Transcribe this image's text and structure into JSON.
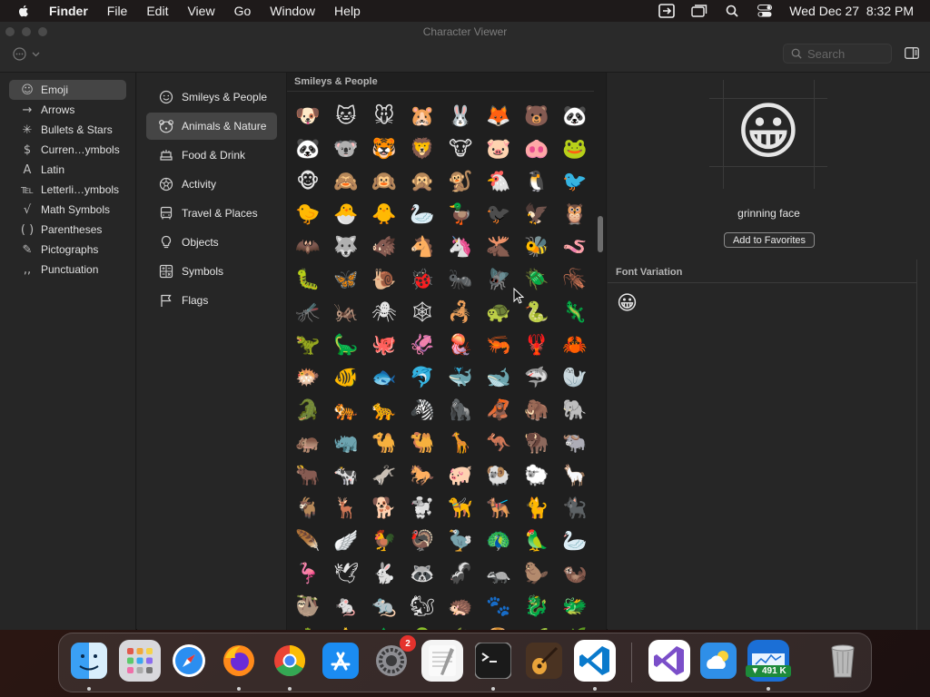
{
  "menubar": {
    "app_name": "Finder",
    "menus": [
      "File",
      "Edit",
      "View",
      "Go",
      "Window",
      "Help"
    ],
    "datetime": "Wed Dec 27  8:32 PM",
    "icons": [
      "apple-icon",
      "screen-mirror-icon",
      "window-icon",
      "search-icon",
      "control-center-icon"
    ]
  },
  "window": {
    "title": "Character Viewer",
    "search_placeholder": "Search"
  },
  "sidebar": {
    "items": [
      {
        "label": "Emoji",
        "icon": "smiley-icon",
        "glyph": "☺"
      },
      {
        "label": "Arrows",
        "icon": "arrow-icon",
        "glyph": "→"
      },
      {
        "label": "Bullets & Stars",
        "icon": "asterisk-icon",
        "glyph": "✳"
      },
      {
        "label": "Curren…ymbols",
        "icon": "dollar-icon",
        "glyph": "$"
      },
      {
        "label": "Latin",
        "icon": "latin-icon",
        "glyph": "A"
      },
      {
        "label": "Letterli…ymbols",
        "icon": "letterlike-icon",
        "glyph": "℡"
      },
      {
        "label": "Math Symbols",
        "icon": "sqrt-icon",
        "glyph": "√"
      },
      {
        "label": "Parentheses",
        "icon": "parentheses-icon",
        "glyph": "( )"
      },
      {
        "label": "Pictographs",
        "icon": "pictograph-icon",
        "glyph": "✎"
      },
      {
        "label": "Punctuation",
        "icon": "punctuation-icon",
        "glyph": ",,"
      }
    ],
    "active_index": 0
  },
  "categories": {
    "items": [
      {
        "label": "Smileys & People",
        "icon": "smiley-outline-icon"
      },
      {
        "label": "Animals & Nature",
        "icon": "bear-icon"
      },
      {
        "label": "Food & Drink",
        "icon": "food-icon"
      },
      {
        "label": "Activity",
        "icon": "soccer-ball-icon"
      },
      {
        "label": "Travel & Places",
        "icon": "bus-icon"
      },
      {
        "label": "Objects",
        "icon": "lightbulb-icon"
      },
      {
        "label": "Symbols",
        "icon": "symbols-icon"
      },
      {
        "label": "Flags",
        "icon": "flag-icon"
      }
    ],
    "active_index": 1
  },
  "grid": {
    "header": "Smileys & People",
    "emojis": [
      "🐶",
      "🐱",
      "🐭",
      "🐹",
      "🐰",
      "🦊",
      "🐻",
      "🐼",
      "🐼",
      "🐨",
      "🐯",
      "🦁",
      "🐮",
      "🐷",
      "🐽",
      "🐸",
      "🐵",
      "🙈",
      "🙉",
      "🙊",
      "🐒",
      "🐔",
      "🐧",
      "🐦",
      "🐤",
      "🐣",
      "🐥",
      "🦢",
      "🦆",
      "🐦‍⬛",
      "🦅",
      "🦉",
      "🦇",
      "🐺",
      "🐗",
      "🐴",
      "🦄",
      "🫎",
      "🐝",
      "🪱",
      "🐛",
      "🦋",
      "🐌",
      "🐞",
      "🐜",
      "🪰",
      "🪲",
      "🪳",
      "🦟",
      "🦗",
      "🕷",
      "🕸",
      "🦂",
      "🐢",
      "🐍",
      "🦎",
      "🦖",
      "🦕",
      "🐙",
      "🦑",
      "🪼",
      "🦐",
      "🦞",
      "🦀",
      "🐡",
      "🐠",
      "🐟",
      "🐬",
      "🐳",
      "🐋",
      "🦈",
      "🦭",
      "🐊",
      "🐅",
      "🐆",
      "🦓",
      "🦍",
      "🦧",
      "🦣",
      "🐘",
      "🦛",
      "🦏",
      "🐪",
      "🐫",
      "🦒",
      "🦘",
      "🦬",
      "🐃",
      "🐂",
      "🐄",
      "🫏",
      "🐎",
      "🐖",
      "🐏",
      "🐑",
      "🦙",
      "🐐",
      "🦌",
      "🐕",
      "🐩",
      "🦮",
      "🐕‍🦺",
      "🐈",
      "🐈‍⬛",
      "🪶",
      "🪽",
      "🐓",
      "🦃",
      "🦤",
      "🦚",
      "🦜",
      "🦢",
      "🦩",
      "🕊",
      "🐇",
      "🦝",
      "🦨",
      "🦡",
      "🦫",
      "🦦",
      "🦥",
      "🐁",
      "🐀",
      "🐿",
      "🦔",
      "🐾",
      "🐉",
      "🐲",
      "🌵",
      "🎄",
      "🌲",
      "🌳",
      "🌴",
      "🪵",
      "🌱",
      "🌿"
    ]
  },
  "detail": {
    "preview_emoji": "😀",
    "char_name": "grinning face",
    "favorites_button": "Add to Favorites",
    "font_variation_label": "Font Variation",
    "variation_emoji": "😀"
  },
  "dock": {
    "apps": [
      {
        "name": "Finder",
        "icon": "finder-icon",
        "color": "#3aa0f5",
        "running": true
      },
      {
        "name": "Launchpad",
        "icon": "launchpad-icon",
        "color": "#d8d8dc",
        "running": false
      },
      {
        "name": "Safari",
        "icon": "safari-icon",
        "color": "#1e88e5",
        "running": false
      },
      {
        "name": "Firefox",
        "icon": "firefox-icon",
        "color": "#ff7a1a",
        "running": true
      },
      {
        "name": "Chrome",
        "icon": "chrome-icon",
        "color": "#ffffff",
        "running": true
      },
      {
        "name": "App Store",
        "icon": "app-store-icon",
        "color": "#1b8cf2",
        "running": false
      },
      {
        "name": "System Settings",
        "icon": "settings-icon",
        "color": "#8e8e93",
        "running": false,
        "badge": "2"
      },
      {
        "name": "TextEdit",
        "icon": "textedit-icon",
        "color": "#f4f4f4",
        "running": false
      },
      {
        "name": "Terminal",
        "icon": "terminal-icon",
        "color": "#1a1a1a",
        "running": true
      },
      {
        "name": "GarageBand",
        "icon": "guitar-icon",
        "color": "#6b4a2a",
        "running": false
      },
      {
        "name": "VS Code",
        "icon": "vscode-icon",
        "color": "#ffffff",
        "running": true
      },
      {
        "name": "Visual Studio",
        "icon": "visual-studio-icon",
        "color": "#ffffff",
        "running": false
      },
      {
        "name": "Weather",
        "icon": "weather-icon",
        "color": "#2f8fe8",
        "running": false
      },
      {
        "name": "Network Monitor",
        "icon": "network-monitor-icon",
        "color": "#1b6fd6",
        "running": true,
        "label": "▼ 491 K"
      },
      {
        "name": "Trash",
        "icon": "trash-icon",
        "color": "#9a9a9a",
        "running": false
      }
    ]
  }
}
